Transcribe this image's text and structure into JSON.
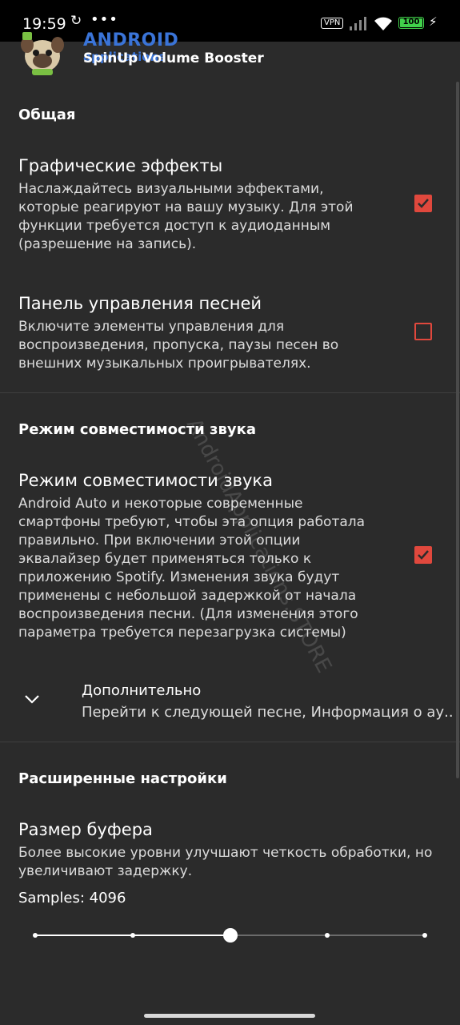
{
  "status_bar": {
    "time": "19:59",
    "more": "•••",
    "vpn": "VPN",
    "battery": "100"
  },
  "app_bar": {
    "logo_word": "ANDROID",
    "logo_sub": "applications",
    "title": "SpinUp Volume Booster"
  },
  "sections": {
    "general": {
      "title": "Общая",
      "graphic_effects": {
        "title": "Графические эффекты",
        "summary": "Наслаждайтесь визуальными эффектами, которые реагируют на вашу музыку. Для этой функции требуется доступ к аудиоданным (разрешение на запись).",
        "checked": true
      },
      "song_panel": {
        "title": "Панель управления песней",
        "summary": "Включите элементы управления для воспроизведения, пропуска, паузы песен во внешних музыкальных проигрывателях.",
        "checked": false
      }
    },
    "compat": {
      "title": "Режим совместимости звука",
      "mode": {
        "title": "Режим совместимости звука",
        "summary": "Android Auto и некоторые современные смартфоны требуют, чтобы эта опция работала правильно. При включении этой опции эквалайзер будет применяться только к приложению Spotify. Изменения звука будут применены с небольшой задержкой от начала воспроизведения песни. (Для изменения этого параметра требуется перезагрузка системы)",
        "checked": true
      },
      "advanced": {
        "title": "Дополнительно",
        "summary": "Перейти к следующей песне, Информация о ау.."
      }
    },
    "extended": {
      "title": "Расширенные настройки",
      "buffer": {
        "title": "Размер буфера",
        "summary": "Более высокие уровни улучшают четкость обработки, но увеличивают задержку.",
        "samples_label": "Samples: 4096",
        "slider_value": 3,
        "slider_steps": 5
      }
    }
  },
  "watermark": "AndroidApplications.STORE",
  "colors": {
    "accent": "#e0483d",
    "background": "#2b2b2b",
    "battery": "#41d14b",
    "logo": "#3a74d8"
  }
}
